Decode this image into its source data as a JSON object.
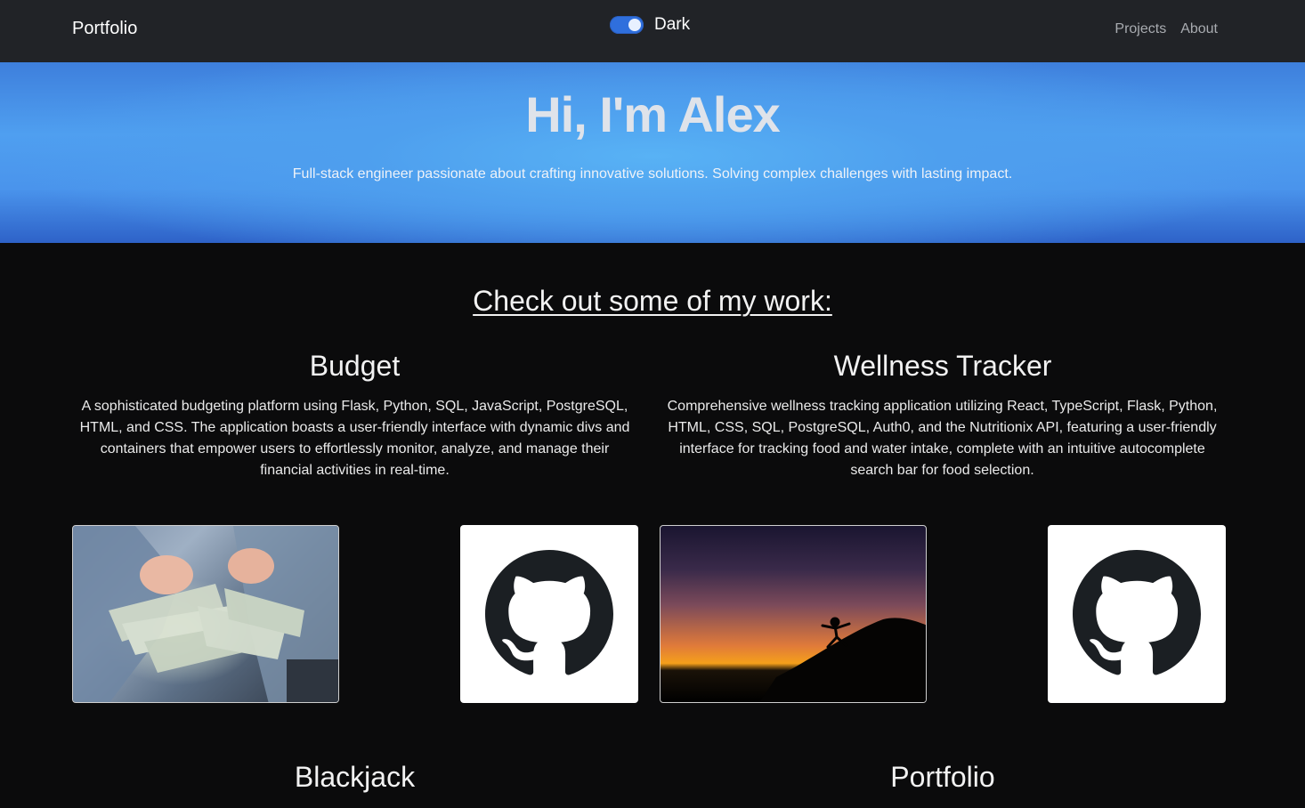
{
  "nav": {
    "brand": "Portfolio",
    "theme_toggle": {
      "label": "Dark",
      "on": true
    },
    "links": [
      "Projects",
      "About"
    ]
  },
  "hero": {
    "title": "Hi, I'm Alex",
    "subtitle": "Full-stack engineer passionate about crafting innovative solutions. Solving complex challenges with lasting impact."
  },
  "work": {
    "heading": "Check out some of my work:",
    "projects": [
      {
        "title": "Budget",
        "description": "A sophisticated budgeting platform using Flask, Python, SQL, JavaScript, PostgreSQL, HTML, and CSS. The application boasts a user-friendly interface with dynamic divs and containers that empower users to effortlessly monitor, analyze, and manage their financial activities in real-time.",
        "image": "hands-holding-cash-photo",
        "link_icon": "github-icon"
      },
      {
        "title": "Wellness Tracker",
        "description": "Comprehensive wellness tracking application utilizing React, TypeScript, Flask, Python, HTML, CSS, SQL, PostgreSQL, Auth0, and the Nutritionix API, featuring a user-friendly interface for tracking food and water intake, complete with an intuitive autocomplete search bar for food selection.",
        "image": "sunset-yoga-silhouette-photo",
        "link_icon": "github-icon"
      },
      {
        "title": "Blackjack"
      },
      {
        "title": "Portfolio"
      }
    ]
  }
}
